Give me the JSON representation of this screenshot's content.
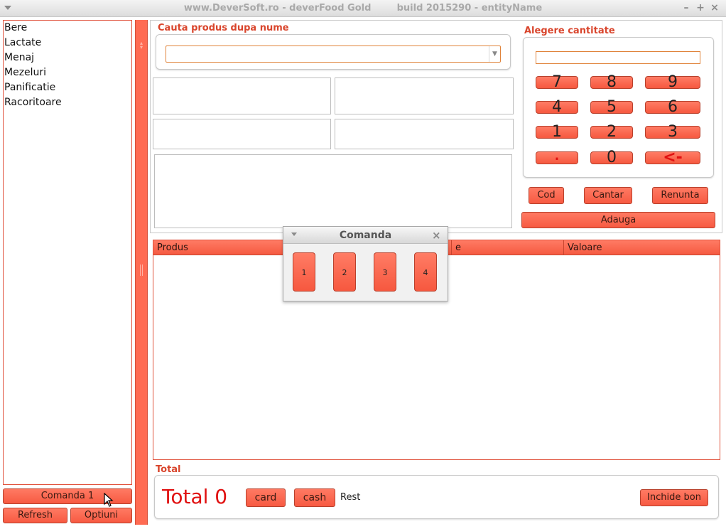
{
  "window": {
    "title": "www.DeverSoft.ro - deverFood Gold        build 2015290 - entityName",
    "minimize": "–",
    "maximize": "+",
    "close": "×"
  },
  "categories": {
    "items": [
      "Bere",
      "Lactate",
      "Menaj",
      "Mezeluri",
      "Panificatie",
      "Racoritoare"
    ]
  },
  "left_buttons": {
    "comanda": "Comanda 1",
    "refresh": "Refresh",
    "optiuni": "Optiuni"
  },
  "search": {
    "label": "Cauta produs dupa nume",
    "value": ""
  },
  "quantity": {
    "label": "Alegere cantitate",
    "value": "",
    "keys": [
      "7",
      "8",
      "9",
      "4",
      "5",
      "6",
      "1",
      "2",
      "3",
      ".",
      "0",
      "<-"
    ],
    "cod": "Cod",
    "cantar": "Cantar",
    "renunta": "Renunta",
    "adauga": "Adauga"
  },
  "table": {
    "columns": [
      "Produs",
      "e",
      "Valoare"
    ]
  },
  "popup": {
    "title": "Comanda",
    "close": "×",
    "buttons": [
      "1",
      "2",
      "3",
      "4"
    ]
  },
  "total": {
    "label": "Total",
    "value": "Total 0",
    "card": "card",
    "cash": "cash",
    "rest": "Rest",
    "inchide": "Inchide bon"
  },
  "colors": {
    "accent": "#f75a42",
    "label_red": "#d9452c",
    "total_red": "#e01010"
  }
}
